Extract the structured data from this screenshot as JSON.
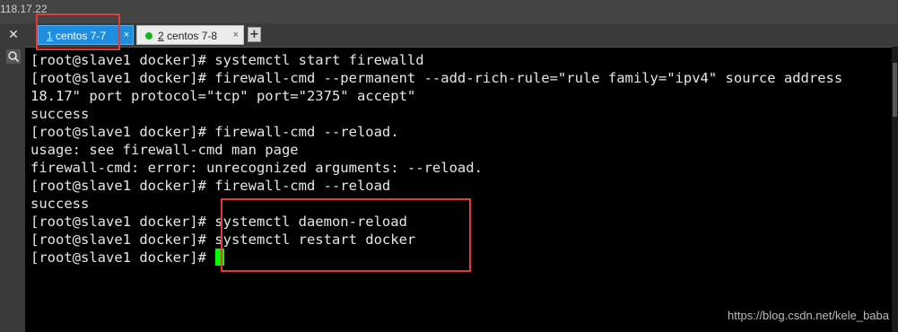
{
  "window": {
    "host_text": "118.17.22"
  },
  "tabs": [
    {
      "number": "1",
      "label": "centos 7-7",
      "close": "×",
      "active": true
    },
    {
      "number": "2",
      "label": "centos 7-8",
      "close": "×",
      "active": false,
      "status_color": "#1fb21f"
    }
  ],
  "toolbar": {
    "close_glyph": "✕",
    "add_tab_glyph": "+"
  },
  "terminal": {
    "lines": [
      "[root@slave1 docker]# systemctl start firewalld",
      "[root@slave1 docker]# firewall-cmd --permanent --add-rich-rule=\"rule family=\"ipv4\" source address",
      "18.17\" port protocol=\"tcp\" port=\"2375\" accept\"",
      "success",
      "[root@slave1 docker]# firewall-cmd --reload.",
      "usage: see firewall-cmd man page",
      "firewall-cmd: error: unrecognized arguments: --reload.",
      "[root@slave1 docker]# firewall-cmd --reload",
      "success",
      "[root@slave1 docker]# systemctl daemon-reload",
      "[root@slave1 docker]# systemctl restart docker",
      "[root@slave1 docker]# "
    ],
    "cursor_color": "#00ff00",
    "text_color": "#e6e6e6",
    "background": "#000000"
  },
  "annotations": {
    "box_color": "#e53935"
  },
  "watermark": "https://blog.csdn.net/kele_baba"
}
